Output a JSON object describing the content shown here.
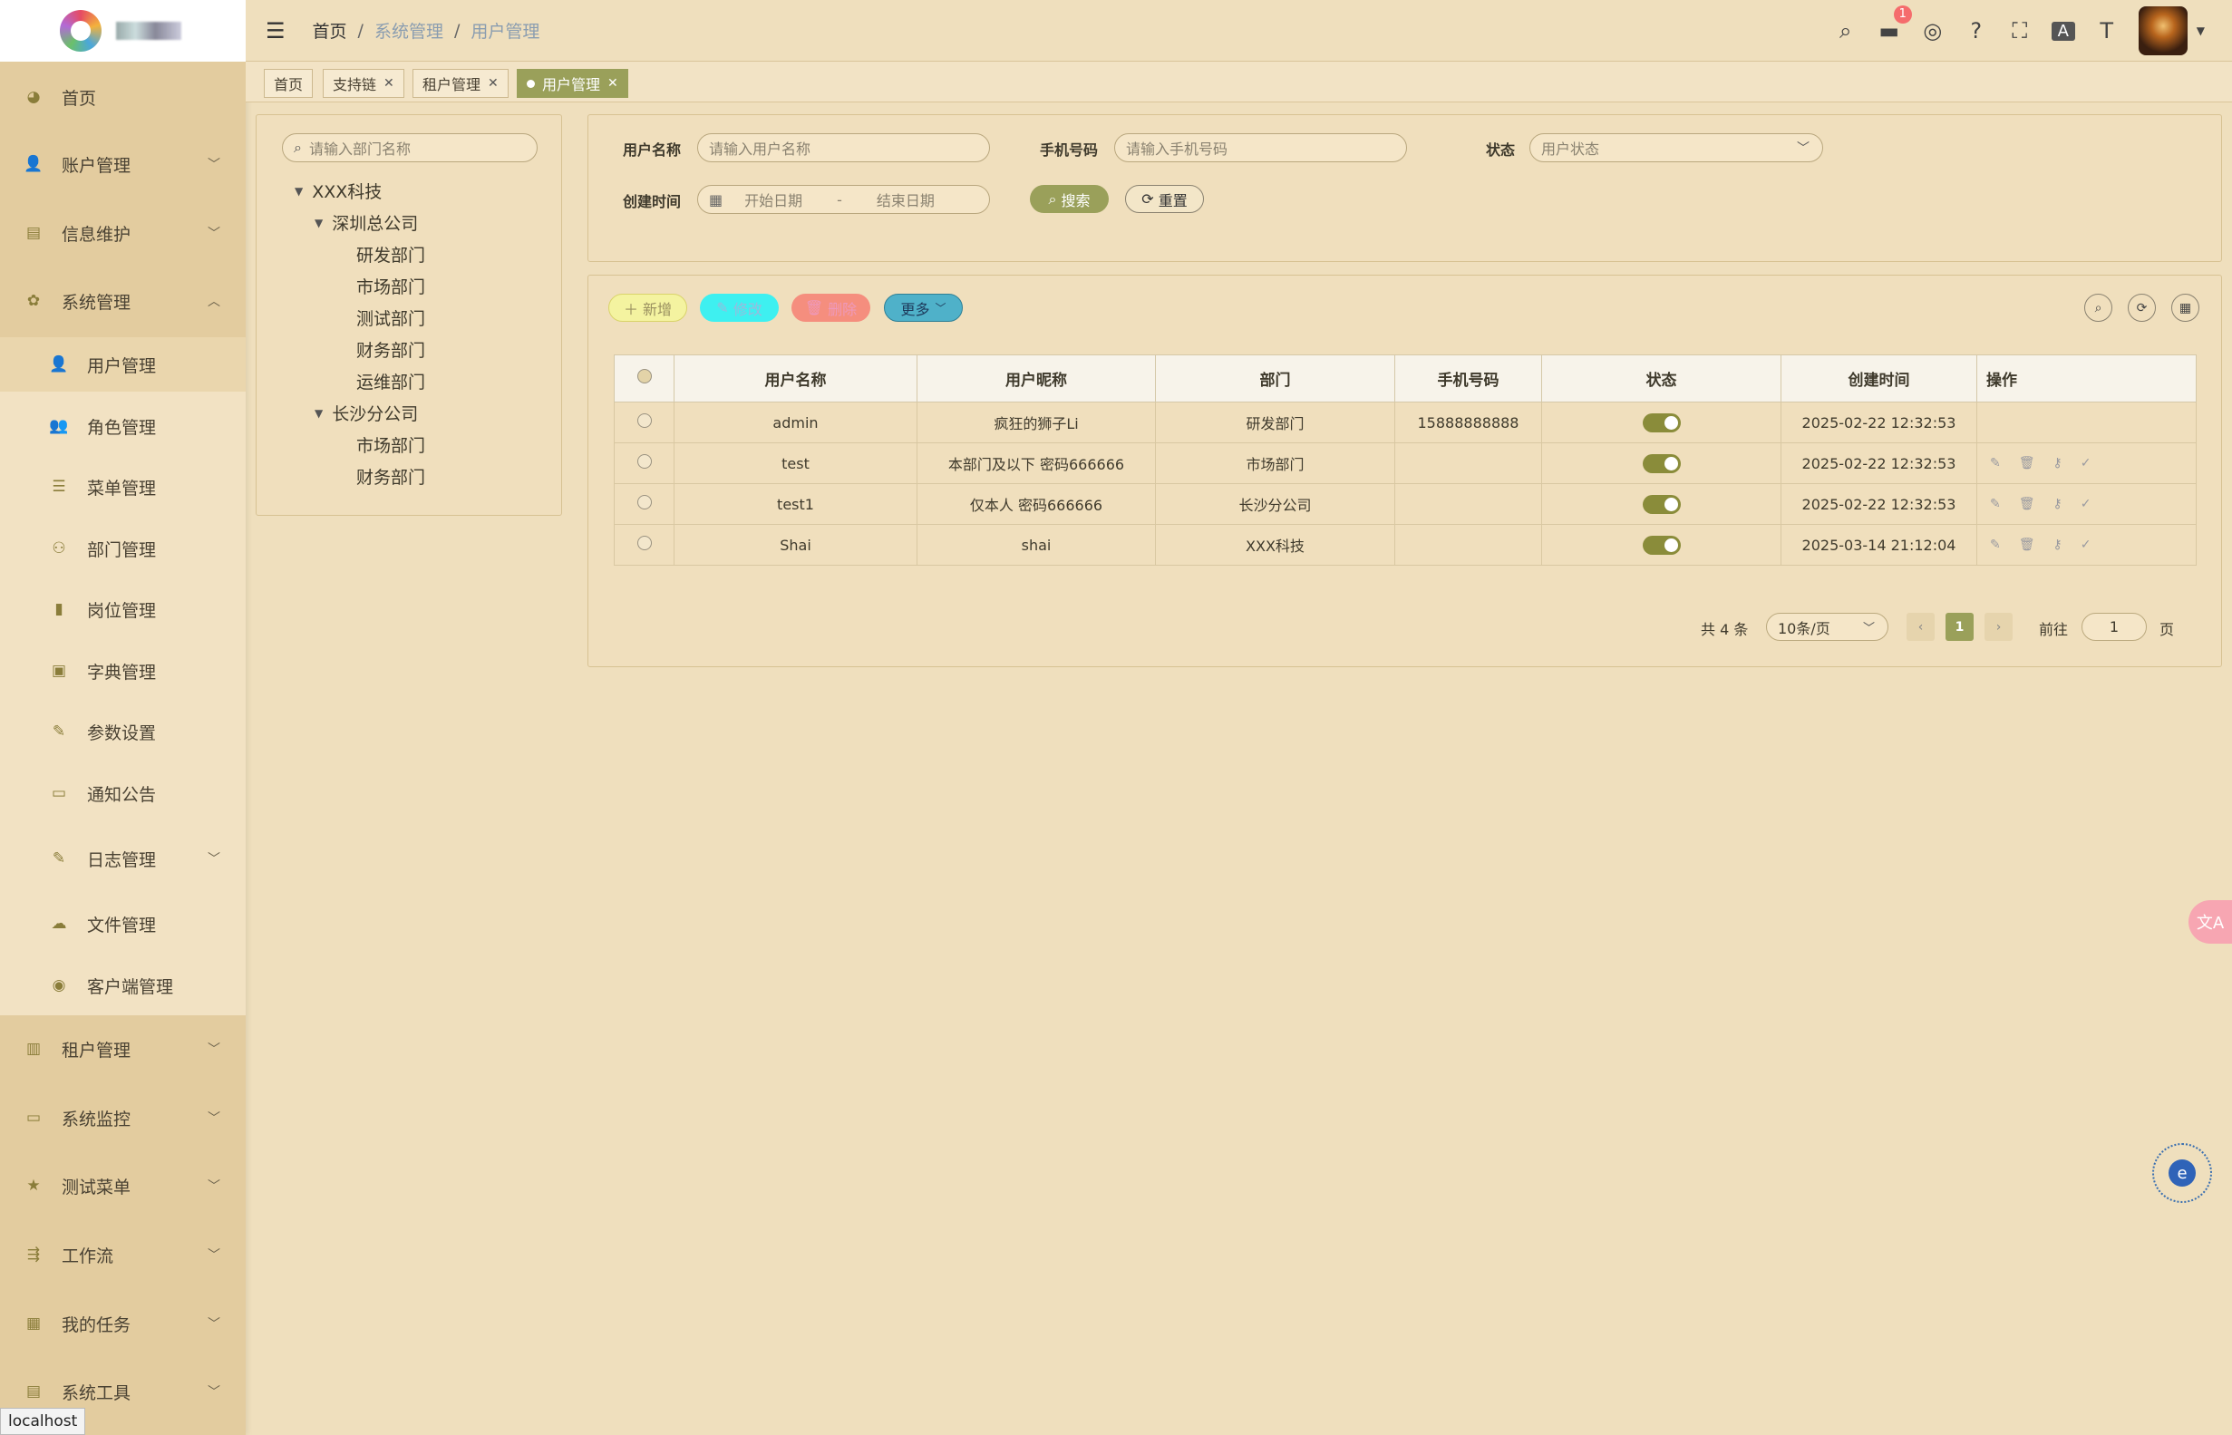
{
  "sidebar": {
    "top_items": [
      {
        "label": "首页",
        "icon": "dashboard-icon"
      },
      {
        "label": "账户管理",
        "icon": "user-icon"
      },
      {
        "label": "信息维护",
        "icon": "document-icon"
      },
      {
        "label": "系统管理",
        "icon": "gear-icon"
      }
    ],
    "sub_items": [
      {
        "label": "用户管理",
        "icon": "user-icon"
      },
      {
        "label": "角色管理",
        "icon": "role-icon"
      },
      {
        "label": "菜单管理",
        "icon": "menu-list-icon"
      },
      {
        "label": "部门管理",
        "icon": "org-tree-icon"
      },
      {
        "label": "岗位管理",
        "icon": "post-icon"
      },
      {
        "label": "字典管理",
        "icon": "dictionary-icon"
      },
      {
        "label": "参数设置",
        "icon": "edit-icon"
      },
      {
        "label": "通知公告",
        "icon": "message-icon"
      },
      {
        "label": "日志管理",
        "icon": "log-icon"
      },
      {
        "label": "文件管理",
        "icon": "upload-icon"
      },
      {
        "label": "客户端管理",
        "icon": "globe-icon"
      }
    ],
    "bottom_items": [
      {
        "label": "租户管理",
        "icon": "chart-icon"
      },
      {
        "label": "系统监控",
        "icon": "monitor-icon"
      },
      {
        "label": "测试菜单",
        "icon": "star-icon"
      },
      {
        "label": "工作流",
        "icon": "workflow-icon"
      },
      {
        "label": "我的任务",
        "icon": "task-icon"
      },
      {
        "label": "系统工具",
        "icon": "toolbox-icon"
      }
    ]
  },
  "header": {
    "breadcrumb": [
      "首页",
      "系统管理",
      "用户管理"
    ],
    "notification_count": "1"
  },
  "tags": [
    {
      "label": "首页"
    },
    {
      "label": "支持链"
    },
    {
      "label": "租户管理"
    },
    {
      "label": "用户管理"
    }
  ],
  "tree": {
    "search_placeholder": "请输入部门名称",
    "root": "XXX科技",
    "branch1": "深圳总公司",
    "branch1_children": [
      "研发部门",
      "市场部门",
      "测试部门",
      "财务部门",
      "运维部门"
    ],
    "branch2": "长沙分公司",
    "branch2_children": [
      "市场部门",
      "财务部门"
    ]
  },
  "search": {
    "username_label": "用户名称",
    "username_placeholder": "请输入用户名称",
    "phone_label": "手机号码",
    "phone_placeholder": "请输入手机号码",
    "status_label": "状态",
    "status_placeholder": "用户状态",
    "created_label": "创建时间",
    "start_placeholder": "开始日期",
    "date_sep": "-",
    "end_placeholder": "结束日期",
    "search_btn": "搜索",
    "reset_btn": "重置"
  },
  "toolbar": {
    "add": "新增",
    "edit": "修改",
    "delete": "删除",
    "more": "更多"
  },
  "table": {
    "columns": [
      "用户名称",
      "用户昵称",
      "部门",
      "手机号码",
      "状态",
      "创建时间",
      "操作"
    ],
    "rows": [
      {
        "username": "admin",
        "nickname": "疯狂的狮子Li",
        "dept": "研发部门",
        "phone": "15888888888",
        "status": true,
        "created": "2025-02-22 12:32:53",
        "ops": false
      },
      {
        "username": "test",
        "nickname": "本部门及以下 密码666666",
        "dept": "市场部门",
        "phone": "",
        "status": true,
        "created": "2025-02-22 12:32:53",
        "ops": true
      },
      {
        "username": "test1",
        "nickname": "仅本人 密码666666",
        "dept": "长沙分公司",
        "phone": "",
        "status": true,
        "created": "2025-02-22 12:32:53",
        "ops": true
      },
      {
        "username": "Shai",
        "nickname": "shai",
        "dept": "XXX科技",
        "phone": "",
        "status": true,
        "created": "2025-03-14 21:12:04",
        "ops": true
      }
    ]
  },
  "pagination": {
    "total": "共 4 条",
    "page_size": "10条/页",
    "current": "1",
    "goto_label": "前往",
    "goto_value": "1",
    "page_suffix": "页"
  },
  "status_bar": "localhost",
  "colors": {
    "accent": "#9aa05a",
    "background": "#efdfbd",
    "sidebar": "#e3cc9f",
    "add_btn": "#f4f3a0",
    "edit_btn": "#3ef0f0",
    "delete_btn": "#f58e7e",
    "more_btn": "#4fb1c9"
  }
}
